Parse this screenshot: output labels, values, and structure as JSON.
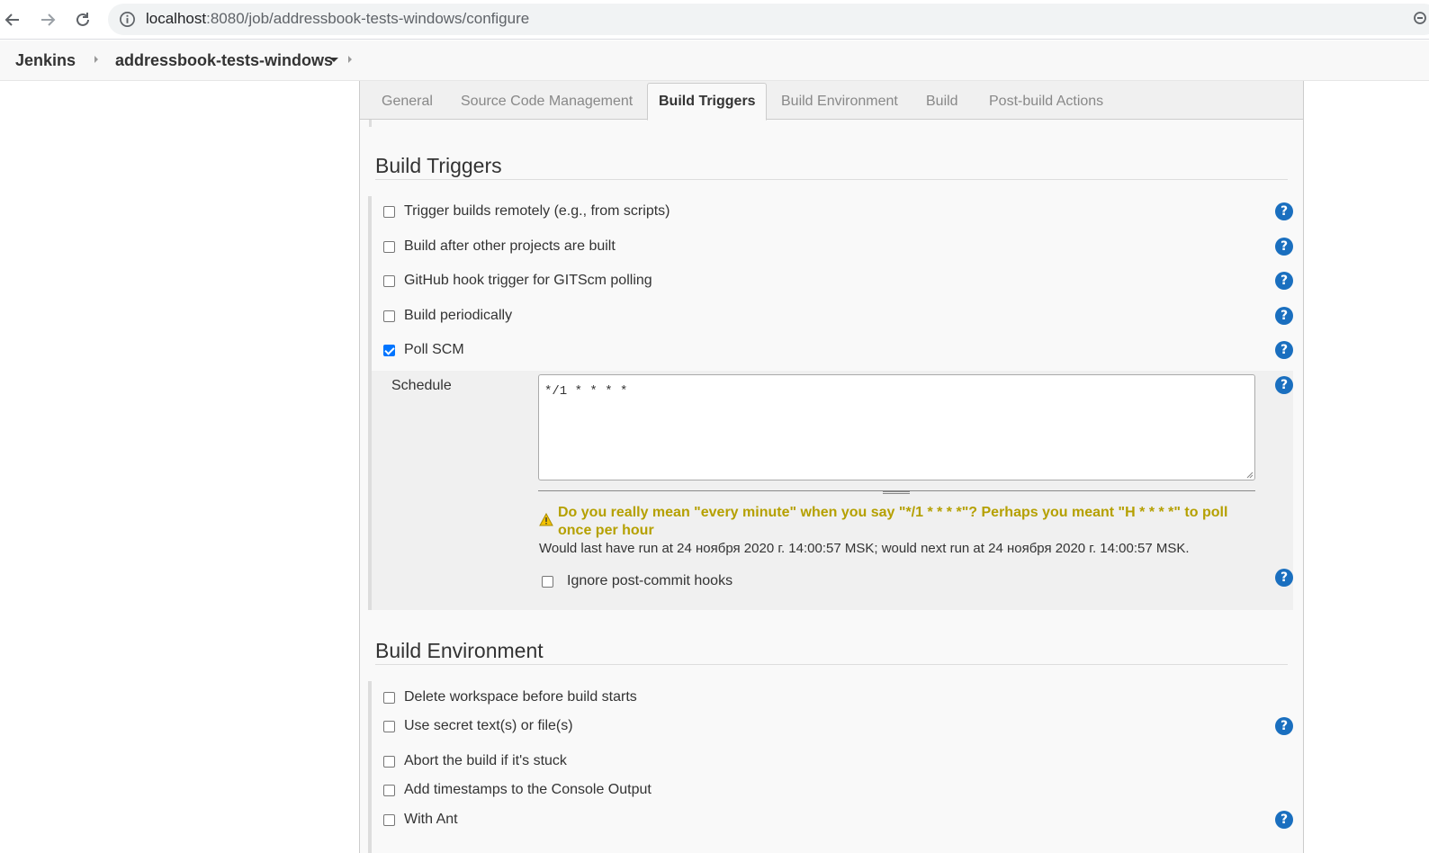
{
  "browser": {
    "url_host": "localhost",
    "url_path": ":8080/job/addressbook-tests-windows/configure"
  },
  "breadcrumb": {
    "root": "Jenkins",
    "job": "addressbook-tests-windows"
  },
  "tabs": [
    {
      "label": "General",
      "active": false
    },
    {
      "label": "Source Code Management",
      "active": false
    },
    {
      "label": "Build Triggers",
      "active": true
    },
    {
      "label": "Build Environment",
      "active": false
    },
    {
      "label": "Build",
      "active": false
    },
    {
      "label": "Post-build Actions",
      "active": false
    }
  ],
  "build_triggers": {
    "title": "Build Triggers",
    "options": [
      {
        "label": "Trigger builds remotely (e.g., from scripts)",
        "checked": false,
        "help": true
      },
      {
        "label": "Build after other projects are built",
        "checked": false,
        "help": true
      },
      {
        "label": "GitHub hook trigger for GITScm polling",
        "checked": false,
        "help": true
      },
      {
        "label": "Build periodically",
        "checked": false,
        "help": true
      },
      {
        "label": "Poll SCM",
        "checked": true,
        "help": true
      }
    ],
    "poll_scm": {
      "schedule_label": "Schedule",
      "schedule_value": "*/1 * * * *",
      "warning": "Do you really mean \"every minute\" when you say \"*/1 * * * *\"? Perhaps you meant \"H * * * *\" to poll once per hour",
      "run_info": "Would last have run at 24 ноября 2020 г. 14:00:57 MSK; would next run at 24 ноября 2020 г. 14:00:57 MSK.",
      "ignore_hooks_label": "Ignore post-commit hooks",
      "ignore_hooks_checked": false
    }
  },
  "build_environment": {
    "title": "Build Environment",
    "options": [
      {
        "label": "Delete workspace before build starts",
        "checked": false,
        "help": false
      },
      {
        "label": "Use secret text(s) or file(s)",
        "checked": false,
        "help": true
      },
      {
        "label": "Abort the build if it's stuck",
        "checked": false,
        "help": false
      },
      {
        "label": "Add timestamps to the Console Output",
        "checked": false,
        "help": false
      },
      {
        "label": "With Ant",
        "checked": false,
        "help": true
      }
    ]
  },
  "help_glyph": "?",
  "colors": {
    "accent": "#1a6fbf",
    "checkbox_checked": "#0075ff",
    "warning": "#b5a000"
  }
}
